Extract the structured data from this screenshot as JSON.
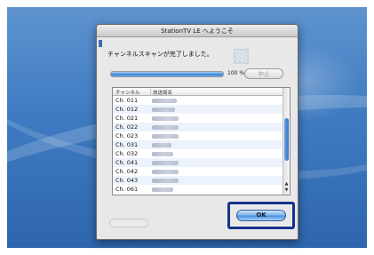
{
  "window": {
    "title": "StationTV LE へようこそ"
  },
  "dialog": {
    "message": "チャンネルスキャンが完了しました。",
    "progress_percent": 100,
    "progress_label": "100 %",
    "stop_label": "中止",
    "ok_label": "OK"
  },
  "list": {
    "columns": [
      "チャンネル",
      "放送局名"
    ],
    "rows": [
      {
        "ch": "Ch. 011"
      },
      {
        "ch": "Ch. 012"
      },
      {
        "ch": "Ch. 021"
      },
      {
        "ch": "Ch. 022"
      },
      {
        "ch": "Ch. 023"
      },
      {
        "ch": "Ch. 031"
      },
      {
        "ch": "Ch. 032"
      },
      {
        "ch": "Ch. 041"
      },
      {
        "ch": "Ch. 042"
      },
      {
        "ch": "Ch. 043"
      },
      {
        "ch": "Ch. 061"
      }
    ]
  },
  "colors": {
    "highlight_frame": "#14318c",
    "desktop": "#3f7bc2",
    "progress": "#3f86d9"
  }
}
